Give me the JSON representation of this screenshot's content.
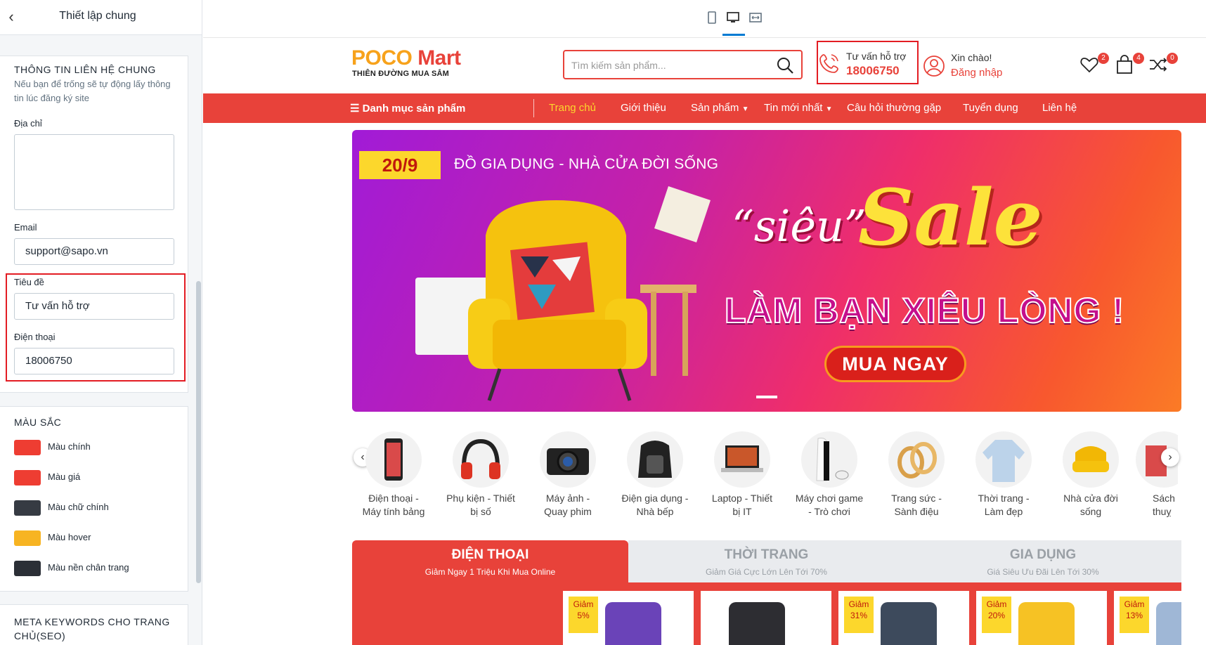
{
  "panel": {
    "title": "Thiết lập chung",
    "contact": {
      "title": "THÔNG TIN LIÊN HỆ CHUNG",
      "desc": "Nếu bạn để trống sẽ tự động lấy thông tin lúc đăng ký site",
      "address_label": "Địa chỉ",
      "address_value": "",
      "email_label": "Email",
      "email_value": "support@sapo.vn",
      "title_label": "Tiêu đề",
      "title_value": "Tư vấn hỗ trợ",
      "phone_label": "Điện thoại",
      "phone_value": "18006750"
    },
    "colors": {
      "title": "MÀU SẮC",
      "items": [
        {
          "label": "Màu chính",
          "color": "#ee3d32"
        },
        {
          "label": "Màu giá",
          "color": "#ee3d32"
        },
        {
          "label": "Màu chữ chính",
          "color": "#363b43"
        },
        {
          "label": "Màu hover",
          "color": "#f7b422"
        },
        {
          "label": "Màu nền chân trang",
          "color": "#2b2f36"
        }
      ]
    },
    "meta": {
      "title": "META KEYWORDS CHO TRANG CHỦ(SEO)"
    }
  },
  "site": {
    "logo_main": "POCO Mart",
    "logo_sub": "THIÊN ĐƯỜNG MUA SẮM",
    "search_placeholder": "Tìm kiếm sản phẩm...",
    "support_title": "Tư vấn hỗ trợ",
    "support_phone": "18006750",
    "greeting": "Xin chào!",
    "login": "Đăng nhập",
    "wishlist_count": "2",
    "cart_count": "4",
    "compare_count": "0",
    "nav": {
      "category": "Danh mục sản phẩm",
      "items": [
        "Trang chủ",
        "Giới thiệu",
        "Sản phẩm",
        "Tin mới nhất",
        "Câu hỏi thường gặp",
        "Tuyển dụng",
        "Liên hệ"
      ]
    },
    "banner": {
      "date": "20/9",
      "headline": "ĐỒ GIA DỤNG - NHÀ CỬA ĐỜI SỐNG",
      "sieu": "“siêu”",
      "sale": "Sale",
      "slogan": "LÀM BẠN XIÊU LÒNG !",
      "button": "MUA NGAY"
    },
    "categories": [
      {
        "line1": "Điện thoại -",
        "line2": "Máy tính bảng"
      },
      {
        "line1": "Phụ kiện - Thiết",
        "line2": "bị số"
      },
      {
        "line1": "Máy ảnh -",
        "line2": "Quay phim"
      },
      {
        "line1": "Điện gia dụng -",
        "line2": "Nhà bếp"
      },
      {
        "line1": "Laptop - Thiết",
        "line2": "bị IT"
      },
      {
        "line1": "Máy chơi game",
        "line2": "- Trò chơi"
      },
      {
        "line1": "Trang sức -",
        "line2": "Sành điệu"
      },
      {
        "line1": "Thời trang -",
        "line2": "Làm đẹp"
      },
      {
        "line1": "Nhà cửa đời",
        "line2": "sống"
      },
      {
        "line1": "Sách -",
        "line2": "thuỵ"
      }
    ],
    "tabs": [
      {
        "title": "ĐIỆN THOẠI",
        "sub": "Giảm Ngay 1 Triệu Khi Mua Online"
      },
      {
        "title": "THỜI TRANG",
        "sub": "Giảm Giá Cực Lớn Lên Tới 70%"
      },
      {
        "title": "GIA DỤNG",
        "sub": "Giá Siêu Ưu Đãi Lên Tới 30%"
      }
    ],
    "product_badges": [
      {
        "label": "Giảm",
        "pct": "5%"
      },
      {
        "label": "",
        "pct": ""
      },
      {
        "label": "Giảm",
        "pct": "31%"
      },
      {
        "label": "Giảm",
        "pct": "20%"
      },
      {
        "label": "Giảm",
        "pct": "13%"
      }
    ]
  }
}
